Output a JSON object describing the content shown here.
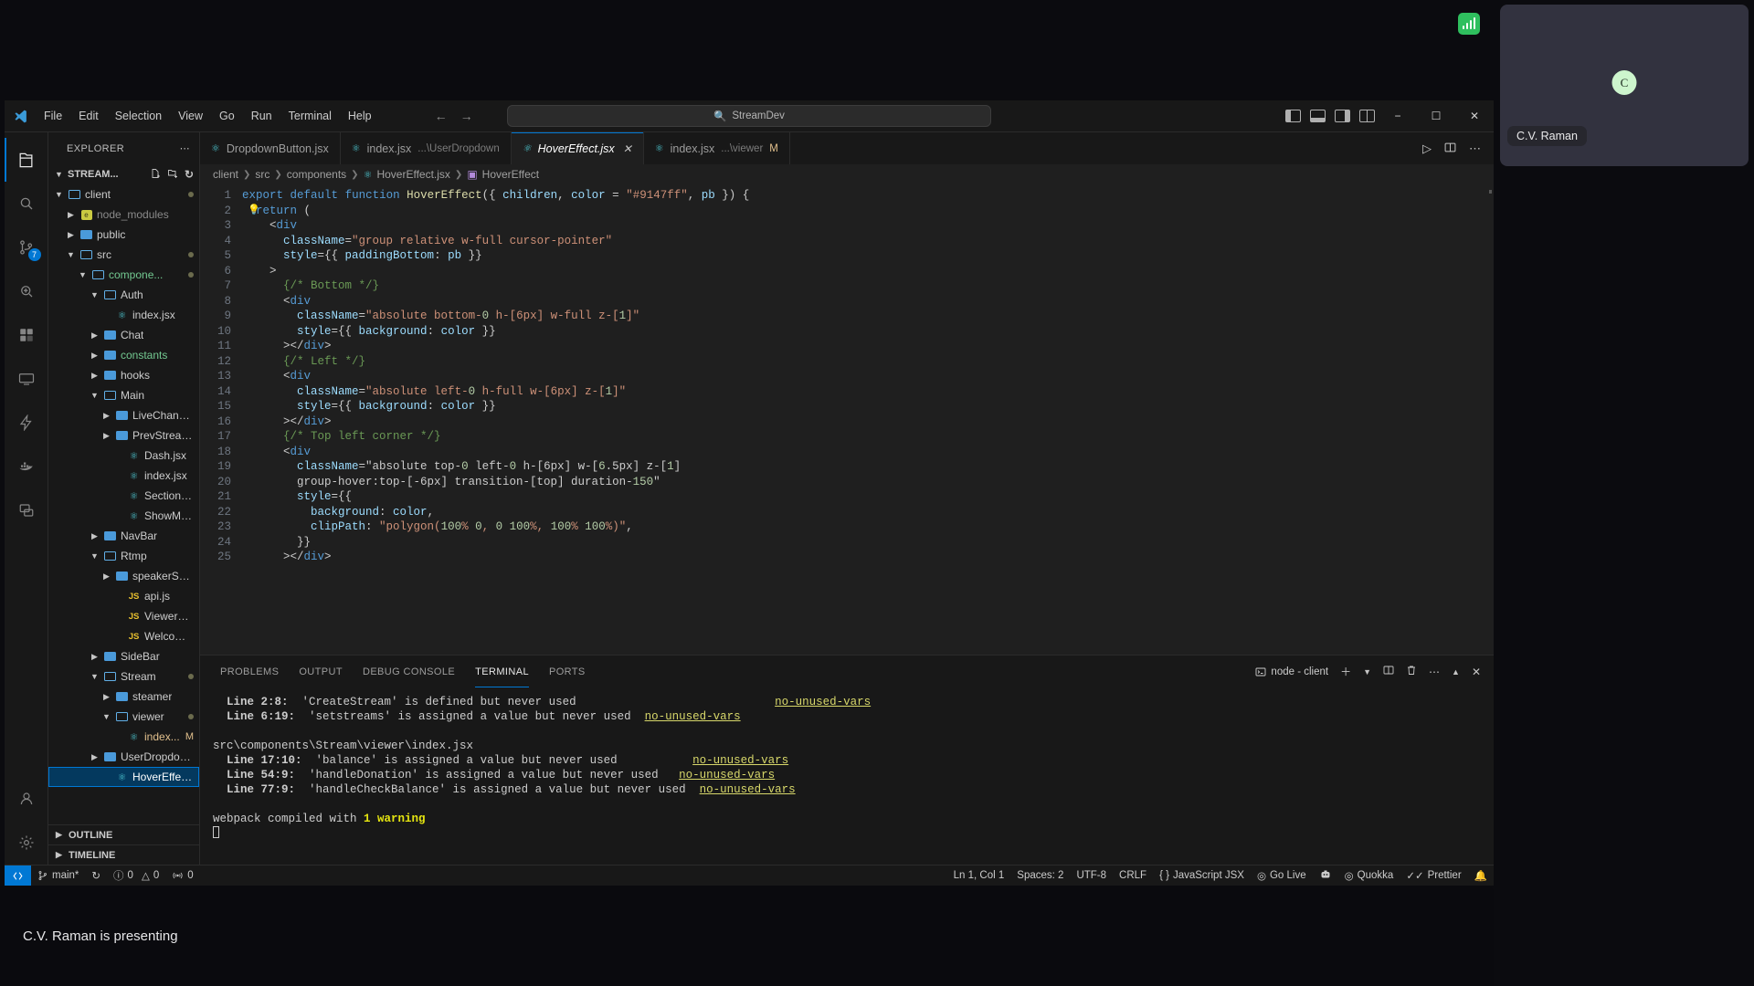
{
  "meet": {
    "signal_icon": "signal-bars-icon",
    "participant": {
      "avatar_initial": "C",
      "name": "C.V. Raman"
    },
    "presenting_status": "C.V. Raman is presenting"
  },
  "window": {
    "titlebar": {
      "logo_icon": "vscode-logo-icon",
      "menu": [
        "File",
        "Edit",
        "Selection",
        "View",
        "Go",
        "Run",
        "Terminal",
        "Help"
      ],
      "back_icon": "arrow-left-icon",
      "forward_icon": "arrow-right-icon",
      "command_center": {
        "search_icon": "search-icon",
        "value": "StreamDev"
      },
      "layout_toggles": [
        "toggle-primary-sidebar",
        "toggle-panel",
        "toggle-secondary-sidebar",
        "customize-layout"
      ],
      "controls": {
        "minimize": "−",
        "maximize": "☐",
        "close": "✕"
      }
    },
    "activitybar": [
      {
        "name": "explorer",
        "icon": "files-icon",
        "badge": ""
      },
      {
        "name": "search",
        "icon": "search-icon",
        "badge": ""
      },
      {
        "name": "source-control",
        "icon": "source-control-icon",
        "badge": "7"
      },
      {
        "name": "run-and-debug",
        "icon": "debug-icon",
        "badge": ""
      },
      {
        "name": "extensions",
        "icon": "extensions-icon",
        "badge": ""
      },
      {
        "name": "remote-explorer",
        "icon": "remote-explorer-icon",
        "badge": ""
      },
      {
        "name": "thunder-client",
        "icon": "thunder-icon",
        "badge": ""
      },
      {
        "name": "docker",
        "icon": "docker-icon",
        "badge": ""
      },
      {
        "name": "live-share",
        "icon": "live-share-icon",
        "badge": ""
      },
      {
        "name": "accounts",
        "icon": "account-icon",
        "badge": ""
      },
      {
        "name": "manage",
        "icon": "gear-icon",
        "badge": ""
      }
    ],
    "sidebar": {
      "title": "EXPLORER",
      "more_actions_icon": "ellipsis-icon",
      "root_label": "STREAM...",
      "root_actions": [
        "new-file-icon",
        "new-folder-icon",
        "refresh-icon",
        "collapse-all-icon"
      ],
      "tree": [
        {
          "label": "client",
          "depth": 0,
          "type": "folder-open",
          "chev": "down",
          "modified_dot": true
        },
        {
          "label": "node_modules",
          "depth": 1,
          "type": "node-modules",
          "chev": "right",
          "dim": true
        },
        {
          "label": "public",
          "depth": 1,
          "type": "folder-closed",
          "chev": "right"
        },
        {
          "label": "src",
          "depth": 1,
          "type": "folder-open",
          "chev": "down",
          "modified_dot": true
        },
        {
          "label": "compone...",
          "depth": 2,
          "type": "folder-open",
          "chev": "down",
          "green": true,
          "modified_dot": true
        },
        {
          "label": "Auth",
          "depth": 3,
          "type": "folder-open",
          "chev": "down"
        },
        {
          "label": "index.jsx",
          "depth": 4,
          "type": "react"
        },
        {
          "label": "Chat",
          "depth": 3,
          "type": "folder-closed",
          "chev": "right"
        },
        {
          "label": "constants",
          "depth": 3,
          "type": "folder-closed",
          "chev": "right",
          "green": true
        },
        {
          "label": "hooks",
          "depth": 3,
          "type": "folder-closed",
          "chev": "right"
        },
        {
          "label": "Main",
          "depth": 3,
          "type": "folder-open",
          "chev": "down"
        },
        {
          "label": "LiveChannels",
          "depth": 4,
          "type": "folder-closed",
          "chev": "right"
        },
        {
          "label": "PrevStreams",
          "depth": 4,
          "type": "folder-closed",
          "chev": "right"
        },
        {
          "label": "Dash.jsx",
          "depth": 5,
          "type": "react"
        },
        {
          "label": "index.jsx",
          "depth": 5,
          "type": "react"
        },
        {
          "label": "SectionTitle.j...",
          "depth": 5,
          "type": "react"
        },
        {
          "label": "ShowMore.jsx",
          "depth": 5,
          "type": "react"
        },
        {
          "label": "NavBar",
          "depth": 3,
          "type": "folder-closed",
          "chev": "right"
        },
        {
          "label": "Rtmp",
          "depth": 3,
          "type": "folder-open",
          "chev": "down"
        },
        {
          "label": "speakerScreen",
          "depth": 4,
          "type": "folder-closed",
          "chev": "right"
        },
        {
          "label": "api.js",
          "depth": 5,
          "type": "js"
        },
        {
          "label": "ViewerScree...",
          "depth": 5,
          "type": "js"
        },
        {
          "label": "WelcomeScr...",
          "depth": 5,
          "type": "js"
        },
        {
          "label": "SideBar",
          "depth": 3,
          "type": "folder-closed",
          "chev": "right"
        },
        {
          "label": "Stream",
          "depth": 3,
          "type": "folder-open",
          "chev": "down",
          "modified_dot": true
        },
        {
          "label": "steamer",
          "depth": 4,
          "type": "folder-closed",
          "chev": "right"
        },
        {
          "label": "viewer",
          "depth": 4,
          "type": "folder-open",
          "chev": "down",
          "modified_dot": true
        },
        {
          "label": "index...",
          "depth": 5,
          "type": "react",
          "badge": "M",
          "modified": true
        },
        {
          "label": "UserDropdown",
          "depth": 3,
          "type": "folder-closed",
          "chev": "right"
        },
        {
          "label": "HoverEffect.jsx",
          "depth": 4,
          "type": "react",
          "selected": true
        }
      ],
      "collapsed_sections": [
        "OUTLINE",
        "TIMELINE"
      ]
    },
    "tabs": [
      {
        "label": "DropdownButton.jsx",
        "icon": "react-icon",
        "active": false,
        "sub": ""
      },
      {
        "label": "index.jsx",
        "icon": "react-icon",
        "active": false,
        "sub": "...\\UserDropdown"
      },
      {
        "label": "HoverEffect.jsx",
        "icon": "react-icon",
        "active": true,
        "sub": "",
        "close_icon": "close-icon"
      },
      {
        "label": "index.jsx",
        "icon": "react-icon",
        "active": false,
        "sub": "...\\viewer",
        "badge": "M"
      }
    ],
    "tab_actions": [
      "run-icon",
      "split-editor-icon",
      "more-actions-icon"
    ],
    "breadcrumb": [
      "client",
      "src",
      "components",
      "HoverEffect.jsx",
      "HoverEffect"
    ],
    "code": {
      "line_count": 25,
      "lines": [
        "export default function HoverEffect({ children, color = \"#9147ff\", pb }) {",
        "  return (",
        "    <div",
        "      className=\"group relative w-full cursor-pointer\"",
        "      style={{ paddingBottom: pb }}",
        "    >",
        "      {/* Bottom */}",
        "      <div",
        "        className=\"absolute bottom-0 h-[6px] w-full z-[1]\"",
        "        style={{ background: color }}",
        "      ></div>",
        "      {/* Left */}",
        "      <div",
        "        className=\"absolute left-0 h-full w-[6px] z-[1]\"",
        "        style={{ background: color }}",
        "      ></div>",
        "      {/* Top left corner */}",
        "      <div",
        "        className=\"absolute top-0 left-0 h-[6px] w-[6.5px] z-[1]",
        "        group-hover:top-[-6px] transition-[top] duration-150\"",
        "        style={{",
        "          background: color,",
        "          clipPath: \"polygon(100% 0, 0 100%, 100% 100%)\",",
        "        }}",
        "      ></div>"
      ],
      "lightbulb_icon": "lightbulb-icon"
    },
    "panel": {
      "tabs": [
        "PROBLEMS",
        "OUTPUT",
        "DEBUG CONSOLE",
        "TERMINAL",
        "PORTS"
      ],
      "active_tab": "TERMINAL",
      "terminal_name": "node - client",
      "terminal_icon": "terminal-icon",
      "actions": [
        "new-terminal-icon",
        "chevron-down-icon",
        "split-terminal-icon",
        "kill-terminal-icon",
        "more-actions-icon",
        "maximize-panel-icon",
        "close-panel-icon"
      ],
      "output": [
        {
          "prefix": "Line 2:8:",
          "text": "'CreateStream' is defined but never used",
          "rule": "no-unused-vars",
          "pad": 28
        },
        {
          "prefix": "Line 6:19:",
          "text": "'setstreams' is assigned a value but never used",
          "rule": "no-unused-vars",
          "pad": 0
        },
        {
          "prefix": "",
          "text": "",
          "rule": "",
          "pad": 0
        },
        {
          "prefix": "",
          "text": "src\\components\\Stream\\viewer\\index.jsx",
          "rule": "",
          "pad": 0,
          "path": true
        },
        {
          "prefix": "Line 17:10:",
          "text": "'balance' is assigned a value but never used",
          "rule": "no-unused-vars",
          "pad": 10
        },
        {
          "prefix": "Line 54:9:",
          "text": "'handleDonation' is assigned a value but never used",
          "rule": "no-unused-vars",
          "pad": 2
        },
        {
          "prefix": "Line 77:9:",
          "text": "'handleCheckBalance' is assigned a value but never used",
          "rule": "no-unused-vars",
          "pad": 0
        }
      ],
      "compile_prefix": "webpack compiled with ",
      "compile_warning": "1 warning"
    },
    "statusbar": {
      "remote_icon": "remote-window-icon",
      "branch": "main*",
      "sync_icon": "sync-icon",
      "errors_icon": "error-icon",
      "errors": "0",
      "warnings_icon": "warning-icon",
      "warnings": "0",
      "ports_icon": "radio-tower-icon",
      "ports": "0",
      "right_items": [
        {
          "name": "cursor-position",
          "label": "Ln 1, Col 1"
        },
        {
          "name": "indentation",
          "label": "Spaces: 2"
        },
        {
          "name": "encoding",
          "label": "UTF-8"
        },
        {
          "name": "eol",
          "label": "CRLF"
        },
        {
          "name": "language-mode",
          "label": "JavaScript JSX",
          "icon": "braces-icon"
        },
        {
          "name": "go-live",
          "label": "Go Live",
          "icon": "broadcast-icon"
        },
        {
          "name": "live-share",
          "label": "",
          "icon": "live-share-icon"
        },
        {
          "name": "quokka",
          "label": "Quokka",
          "icon": "quokka-icon"
        },
        {
          "name": "prettier",
          "label": "Prettier",
          "icon": "check-check-icon"
        },
        {
          "name": "notifications",
          "label": "",
          "icon": "bell-icon"
        }
      ]
    }
  },
  "colors": {
    "accent": "#0078d4",
    "editor_bg": "#1f1f1f",
    "chrome_bg": "#181818",
    "selection": "#04395e",
    "warning": "#e5e510",
    "green_badge": "#2fbf5e"
  }
}
